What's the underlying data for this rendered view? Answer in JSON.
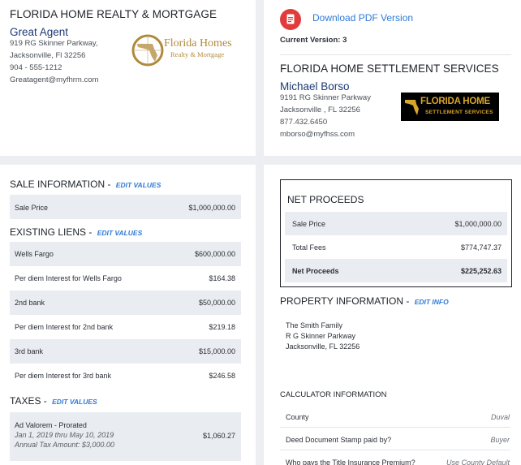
{
  "agent_card": {
    "company": "FLORIDA HOME REALTY & MORTGAGE",
    "name": "Great Agent",
    "address1": "919 RG Skinner Parkway,",
    "address2": "Jacksonville, Fl 32256",
    "phone": "904 - 555-1212",
    "email": "Greatagent@myfhrm.com",
    "logo_text": "Florida Homes",
    "logo_sub": "Realty & Mortgage"
  },
  "settlement_card": {
    "pdf_link": "Download PDF Version",
    "version": "Current Version: 3",
    "company": "FLORIDA HOME SETTLEMENT SERVICES",
    "name": "Michael Borso",
    "address1": "9191 RG Skinner Parkway",
    "address2": "Jacksonville , FL 32256",
    "phone": "877.432.6450",
    "email": "mborso@myfhss.com",
    "logo_text": "FLORIDA HOME",
    "logo_sub": "SETTLEMENT SERVICES"
  },
  "sale_information": {
    "title": "SALE INFORMATION -",
    "edit": "EDIT VALUES",
    "rows": [
      {
        "label": "Sale Price",
        "value": "$1,000,000.00"
      }
    ]
  },
  "existing_liens": {
    "title": "EXISTING LIENS -",
    "edit": "EDIT VALUES",
    "rows": [
      {
        "label": "Wells Fargo",
        "value": "$600,000.00"
      },
      {
        "label": "Per diem Interest for Wells Fargo",
        "value": "$164.38"
      },
      {
        "label": "2nd bank",
        "value": "$50,000.00"
      },
      {
        "label": "Per diem Interest for 2nd bank",
        "value": "$219.18"
      },
      {
        "label": "3rd bank",
        "value": "$15,000.00"
      },
      {
        "label": "Per diem Interest for 3rd bank",
        "value": "$246.58"
      }
    ]
  },
  "taxes": {
    "title": "TAXES -",
    "edit": "EDIT VALUES",
    "row": {
      "label": "Ad Valorem - Prorated",
      "dates": "Jan 1, 2019 thru May 10, 2019",
      "annual": "Annual Tax Amount: $3,000.00",
      "value": "$1,060.27"
    }
  },
  "net_proceeds": {
    "title": "NET PROCEEDS",
    "rows": [
      {
        "label": "Sale Price",
        "value": "$1,000,000.00"
      },
      {
        "label": "Total Fees",
        "value": "$774,747.37"
      },
      {
        "label": "Net Proceeds",
        "value": "$225,252.63"
      }
    ]
  },
  "property_information": {
    "title": "PROPERTY INFORMATION -",
    "edit": "EDIT INFO",
    "line1": "The Smith Family",
    "line2": "R G Skinner Parkway",
    "line3": "Jacksonville, FL 32256"
  },
  "calculator_information": {
    "title": "CALCULATOR INFORMATION",
    "rows": [
      {
        "label": "County",
        "value": "Duval"
      },
      {
        "label": "Deed Document Stamp paid by?",
        "value": "Buyer"
      },
      {
        "label": "Who pays the Title Insurance Premium?",
        "value": "Use County Default"
      }
    ]
  },
  "colors": {
    "link": "#2f7ad6",
    "pdf_icon": "#e23b3b",
    "agent_name": "#1f3a75",
    "row_shade": "#e9ecf0",
    "logo_gold": "#b08a3c"
  },
  "icons": {
    "pdf": "pdf-file-icon",
    "agent_logo": "florida-homes-logo",
    "settlement_logo": "florida-home-settlement-logo"
  }
}
